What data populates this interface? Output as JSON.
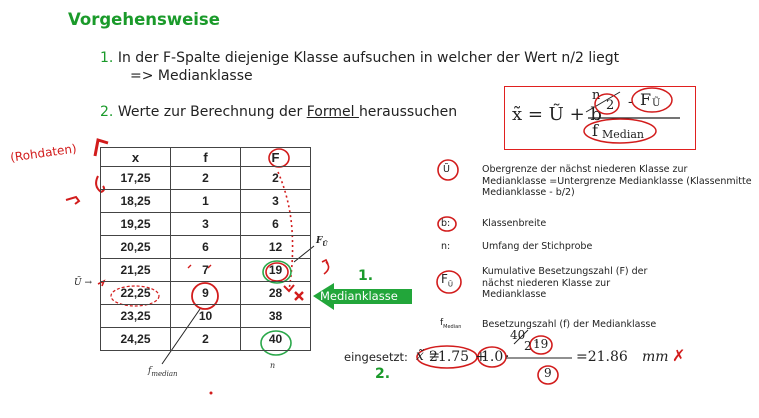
{
  "heading": "Vorgehensweise",
  "steps": [
    {
      "num": "1.",
      "text": "In der F-Spalte diejenige Klasse aufsuchen in welcher der Wert n/2 liegt",
      "text2": "=> Medianklasse"
    },
    {
      "num": "2.",
      "text_pre": "Werte zur Berechnung der ",
      "text_link": "Formel ",
      "text_post": "heraussuchen"
    }
  ],
  "formula": {
    "lhs": "x̃ = Ũ + b",
    "num_n": "n",
    "num_2": "2",
    "num_minus": "-",
    "num_F": "F",
    "num_Fsub": "Ũ",
    "den_f": "f",
    "den_sub": "Median"
  },
  "table": {
    "headers": [
      "x",
      "f",
      "F"
    ],
    "rows": [
      [
        "17,25",
        "2",
        "2"
      ],
      [
        "18,25",
        "1",
        "3"
      ],
      [
        "19,25",
        "3",
        "6"
      ],
      [
        "20,25",
        "6",
        "12"
      ],
      [
        "21,25",
        "7",
        "19"
      ],
      [
        "22,25",
        "9",
        "28"
      ],
      [
        "23,25",
        "10",
        "38"
      ],
      [
        "24,25",
        "2",
        "40"
      ]
    ],
    "f_median_label": "f",
    "f_median_sub": "median",
    "n_label": "n",
    "FU_label": "F",
    "FU_sub": "Ũ",
    "U_marker": "Ũ →"
  },
  "legend": [
    {
      "sym": "Ũ",
      "text": "Obergrenze der nächst niederen Klasse zur Medianklasse =Untergrenze Medianklasse (Klassenmitte Medianklasse - b/2)"
    },
    {
      "sym": "b:",
      "text": "Klassenbreite"
    },
    {
      "sym": "n:",
      "text": "Umfang der Stichprobe"
    },
    {
      "sym": "F",
      "sym_sub": "Ũ",
      "text": "Kumulative Besetzungszahl (F) der nächst niederen Klasse zur Medianklasse"
    },
    {
      "sym": "f",
      "sym_sub": "Median",
      "text": "Besetzungszahl (f) der Medianklasse"
    }
  ],
  "annotations": {
    "handwritten_left": "(Rohdaten)",
    "arrow_label_num": "1.",
    "arrow_label": "Medianklasse",
    "calc_num": "2."
  },
  "calc": {
    "label": "eingesetzt:",
    "lhs": "x̃ =",
    "a": "21.75",
    "plus": "+",
    "b": "1.0",
    "dot": "·",
    "num_top": "40",
    "num_2": "2",
    "minus": "-",
    "num_19": "19",
    "den_9": "9",
    "result": "=21.86",
    "unit": "mm",
    "mark": "✗"
  },
  "colors": {
    "green": "#1a9a2a",
    "red": "#d21c1c",
    "arrow_green": "#22a63a"
  }
}
